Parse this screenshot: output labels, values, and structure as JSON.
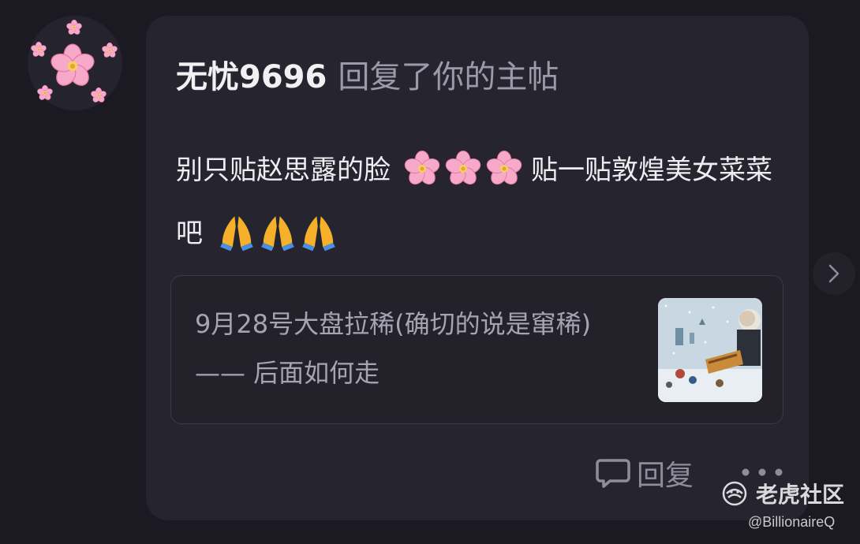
{
  "comment": {
    "username": "无忧9696",
    "action": "回复了你的主帖",
    "text_part1": "别只贴赵思露的脸",
    "text_part2": "贴一贴敦煌美女菜菜吧",
    "emojis_flowers": [
      "cherry-blossom",
      "cherry-blossom",
      "cherry-blossom"
    ],
    "emojis_hands": [
      "folded-hands",
      "folded-hands",
      "folded-hands"
    ]
  },
  "quoted_post": {
    "title": "9月28号大盘拉稀(确切的说是窜稀) —— 后面如何走"
  },
  "actions": {
    "reply_label": "回复"
  },
  "watermark": {
    "brand": "老虎社区",
    "handle": "@BillionaireQ"
  },
  "colors": {
    "background": "#1b1a22",
    "card": "#26252f",
    "primary_text": "#eeeef2",
    "secondary_text": "#9c9aa9"
  }
}
